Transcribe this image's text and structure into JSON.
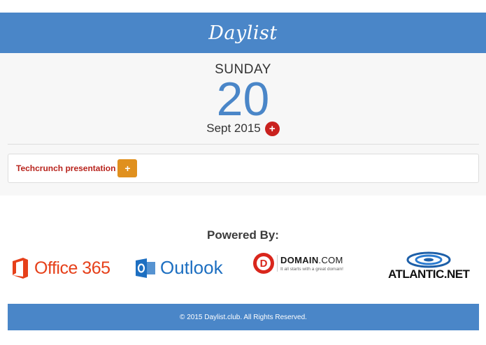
{
  "header": {
    "brand": "Daylist"
  },
  "date": {
    "day_name": "SUNDAY",
    "day_number": "20",
    "month_year": "Sept 2015",
    "add_label": "+"
  },
  "tasks": [
    {
      "title": "Techcrunch presentation",
      "add_label": "+"
    }
  ],
  "powered": {
    "heading": "Powered By:"
  },
  "sponsors": {
    "office": "Office 365",
    "outlook": "Outlook",
    "domain_name": "DOMAIN",
    "domain_suffix": ".COM",
    "domain_tagline": "It all starts with a great domain!",
    "atlantic": "ATLANTIC.NET"
  },
  "footer": {
    "copyright": "© 2015 Daylist.club. All Rights Reserved."
  },
  "colors": {
    "brand_blue": "#4a86c8",
    "accent_red": "#c9211e",
    "task_add_orange": "#e0901e",
    "task_text_red": "#b8231c"
  }
}
